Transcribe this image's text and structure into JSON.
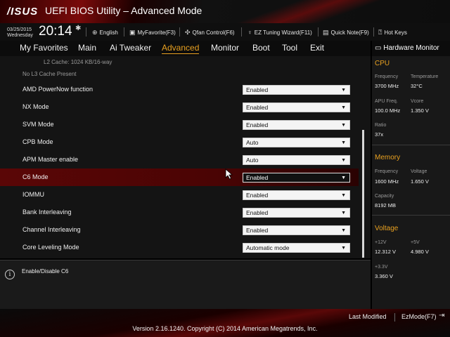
{
  "header": {
    "logo": "/ISUS",
    "title": "UEFI BIOS Utility – Advanced Mode"
  },
  "infobar": {
    "date": "03/25/2015",
    "weekday": "Wednesday",
    "time": "20:14",
    "language": "English",
    "myfavorite": "MyFavorite(F3)",
    "qfan": "Qfan Control(F6)",
    "ez_tuning": "EZ Tuning Wizard(F11)",
    "quick_note": "Quick Note(F9)",
    "hot_keys": "Hot Keys"
  },
  "menu": {
    "items": [
      "My Favorites",
      "Main",
      "Ai Tweaker",
      "Advanced",
      "Monitor",
      "Boot",
      "Tool",
      "Exit"
    ],
    "active": "Advanced"
  },
  "main": {
    "info": [
      "L2 Cache: 1024 KB/16-way",
      "No L3 Cache Present"
    ],
    "settings": [
      {
        "label": "AMD PowerNow function",
        "value": "Enabled"
      },
      {
        "label": "NX Mode",
        "value": "Enabled"
      },
      {
        "label": "SVM Mode",
        "value": "Enabled"
      },
      {
        "label": "CPB Mode",
        "value": "Auto"
      },
      {
        "label": "APM Master enable",
        "value": "Auto"
      },
      {
        "label": "C6 Mode",
        "value": "Enabled",
        "selected": true
      },
      {
        "label": "IOMMU",
        "value": "Enabled"
      },
      {
        "label": "Bank Interleaving",
        "value": "Enabled"
      },
      {
        "label": "Channel Interleaving",
        "value": "Enabled"
      },
      {
        "label": "Core Leveling Mode",
        "value": "Automatic mode"
      }
    ]
  },
  "help": {
    "text": "Enable/Disable C6"
  },
  "hardware_monitor": {
    "title": "Hardware Monitor",
    "cpu": {
      "heading": "CPU",
      "frequency_label": "Frequency",
      "frequency": "3700 MHz",
      "temperature_label": "Temperature",
      "temperature": "32°C",
      "apu_label": "APU Freq.",
      "apu": "100.0 MHz",
      "vcore_label": "Vcore",
      "vcore": "1.350 V",
      "ratio_label": "Ratio",
      "ratio": "37x"
    },
    "memory": {
      "heading": "Memory",
      "frequency_label": "Frequency",
      "frequency": "1600 MHz",
      "voltage_label": "Voltage",
      "voltage": "1.650 V",
      "capacity_label": "Capacity",
      "capacity": "8192 MB"
    },
    "voltage": {
      "heading": "Voltage",
      "v12_label": "+12V",
      "v12": "12.312 V",
      "v5_label": "+5V",
      "v5": "4.980 V",
      "v33_label": "+3.3V",
      "v33": "3.360 V"
    }
  },
  "bottom": {
    "last_modified": "Last Modified",
    "ezmode": "EzMode(F7)",
    "version": "Version 2.16.1240. Copyright (C) 2014 American Megatrends, Inc."
  },
  "colors": {
    "accent": "#e8a020",
    "selected_row": "#5a0606",
    "brand_red": "#7a0a0a"
  }
}
